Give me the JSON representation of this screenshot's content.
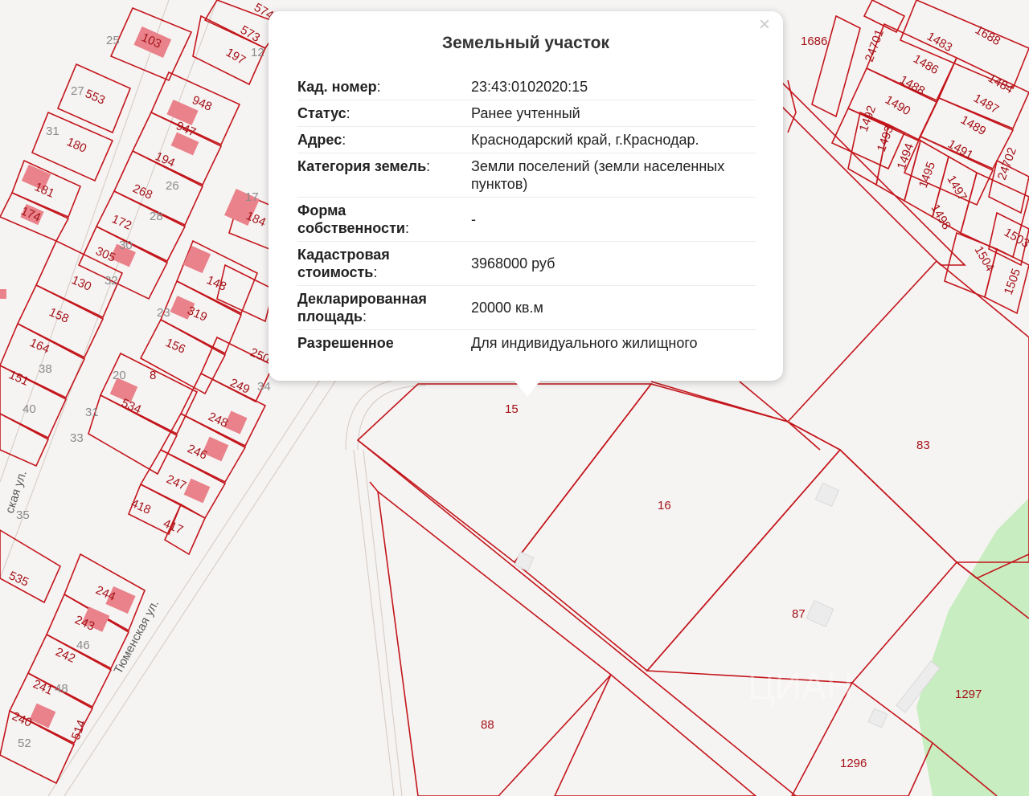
{
  "popup": {
    "title": "Земельный участок",
    "close_glyph": "×",
    "rows": [
      {
        "key": "Кад. номер",
        "colon": ":",
        "value": "23:43:0102020:15"
      },
      {
        "key": "Статус",
        "colon": ":",
        "value": "Ранее учтенный"
      },
      {
        "key": "Адрес",
        "colon": ":",
        "value": "Краснодарский край, г.Краснодар."
      },
      {
        "key": "Категория земель",
        "colon": ":",
        "value": "Земли поселений (земли населенных пунктов)"
      },
      {
        "key": "Форма собственности",
        "colon": ":",
        "value": "-"
      },
      {
        "key": "Кадастровая стоимость",
        "colon": ":",
        "value": "3968000 руб"
      },
      {
        "key": "Декларированная площадь",
        "colon": ":",
        "value": "20000 кв.м"
      },
      {
        "key": "Разрешенное",
        "colon": "",
        "value": "Для индивидуального жилищного"
      }
    ]
  },
  "map": {
    "streets": {
      "tyumenskaya": "Тюменская ул.",
      "left_street": "ская ул."
    },
    "watermark": "ЦИАН",
    "labels": {
      "p103": "103",
      "p25": "25",
      "p553": "553",
      "p27": "27",
      "p31": "31",
      "p180": "180",
      "p181": "181",
      "p174": "174",
      "p948": "948",
      "p947": "947",
      "p194": "194",
      "p268": "268",
      "p172": "172",
      "p305": "305",
      "p130": "130",
      "p158": "158",
      "p164": "164",
      "p151": "151",
      "p148": "148",
      "p319": "319",
      "p156": "156",
      "p8": "8",
      "p534": "534",
      "p250": "250",
      "p249": "249",
      "p248": "248",
      "p246": "246",
      "p247": "247",
      "p418": "418",
      "p417": "417",
      "p244": "244",
      "p243": "243",
      "p242": "242",
      "p241": "241",
      "p240": "240",
      "p535": "535",
      "p514": "514",
      "p184": "184",
      "p573": "573",
      "p574": "574",
      "p197": "197",
      "p12": "12",
      "p15": "15",
      "p16": "16",
      "p83": "83",
      "p87": "87",
      "p88": "88",
      "p1296": "1296",
      "p1297": "1297",
      "p1686": "1686",
      "p1688": "1688",
      "p1483": "1483",
      "p1484": "1484",
      "p1486": "1486",
      "p1487": "1487",
      "p1488": "1488",
      "p1489": "1489",
      "p1490": "1490",
      "p1491": "1491",
      "p1492": "1492",
      "p1493": "1493",
      "p1494": "1494",
      "p1495": "1495",
      "p1497": "1497",
      "p1498": "1498",
      "p1503": "1503",
      "p1504": "1504",
      "p1505": "1505",
      "p24701": "24701",
      "p24702": "24702",
      "g31": "31",
      "g33": "33",
      "g35": "35",
      "g34": "34",
      "g38": "38",
      "g40": "40",
      "g30": "30",
      "g32": "32",
      "g28": "28",
      "g26": "26",
      "g23": "23",
      "g20": "20",
      "g46": "46",
      "g48": "48",
      "g52": "52",
      "g17": "17"
    }
  }
}
